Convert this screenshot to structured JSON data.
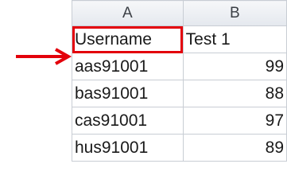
{
  "columns": [
    "A",
    "B"
  ],
  "header_row": [
    "Username",
    "Test 1"
  ],
  "rows": [
    [
      "aas91001",
      "99"
    ],
    [
      "bas91001",
      "88"
    ],
    [
      "cas91001",
      "97"
    ],
    [
      "hus91001",
      "89"
    ]
  ],
  "colors": {
    "highlight": "#e3000b",
    "arrow": "#e3000b",
    "grid": "#c8cdd4",
    "col_header_bg": "#e9ecf1"
  },
  "icons": {
    "pointer": "right-arrow-icon"
  }
}
